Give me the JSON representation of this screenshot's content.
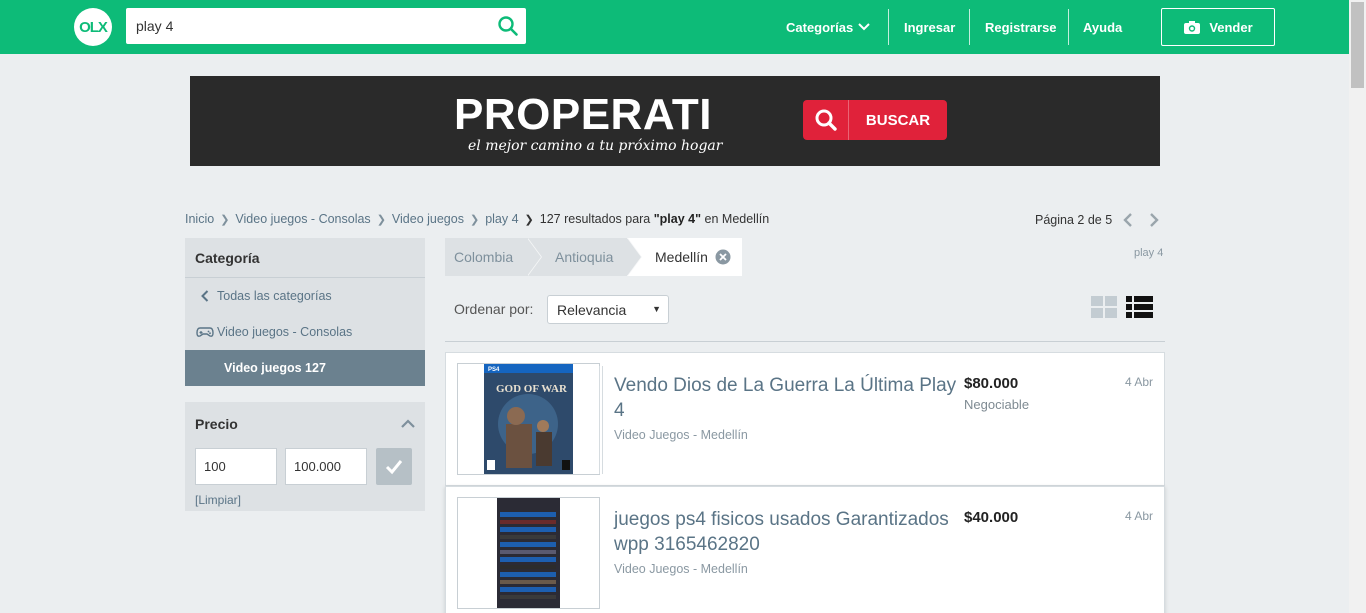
{
  "header": {
    "logo_text": "OLX",
    "search_value": "play 4",
    "nav": {
      "categorias": "Categorías",
      "ingresar": "Ingresar",
      "registrarse": "Registrarse",
      "ayuda": "Ayuda"
    },
    "sell_label": "Vender"
  },
  "banner": {
    "title": "PROPERATI",
    "subtitle": "el mejor camino a tu próximo hogar",
    "button_label": "BUSCAR"
  },
  "breadcrumb": {
    "items": [
      "Inicio",
      "Video juegos - Consolas",
      "Video juegos",
      "play 4"
    ],
    "result_prefix": "127 resultados para",
    "query": "\"play 4\"",
    "result_suffix": "en Medellín"
  },
  "pagination": {
    "label": "Página 2 de 5"
  },
  "sidebar": {
    "category_title": "Categoría",
    "all_categories": "Todas las categorías",
    "parent_category": "Video juegos - Consolas",
    "active_category": "Video juegos 127",
    "price_title": "Precio",
    "price_min": "100",
    "price_max": "100.000",
    "clear_label": "[Limpiar]"
  },
  "location": {
    "items": [
      "Colombia",
      "Antioquia",
      "Medellín"
    ],
    "search_tag": "play 4"
  },
  "sort": {
    "label": "Ordenar por:",
    "selected": "Relevancia"
  },
  "listings": [
    {
      "title": "Vendo Dios de La Guerra La Última Play 4",
      "subtitle": "Video Juegos - Medellín",
      "price": "$80.000",
      "negotiable": "Negociable",
      "date": "4 Abr"
    },
    {
      "title": "juegos ps4 fisicos usados Garantizados wpp 3165462820",
      "subtitle": "Video Juegos - Medellín",
      "price": "$40.000",
      "negotiable": "",
      "date": "4 Abr"
    }
  ],
  "colors": {
    "brand": "#0dbb78",
    "banner_bg": "#2a2a2a",
    "banner_button": "#e0223a",
    "active_category": "#6b818f",
    "link": "#5a7486"
  },
  "icons": {
    "search": "search-icon",
    "camera": "camera-icon",
    "chevron_down": "chevron-down-icon",
    "gamepad": "gamepad-icon"
  }
}
